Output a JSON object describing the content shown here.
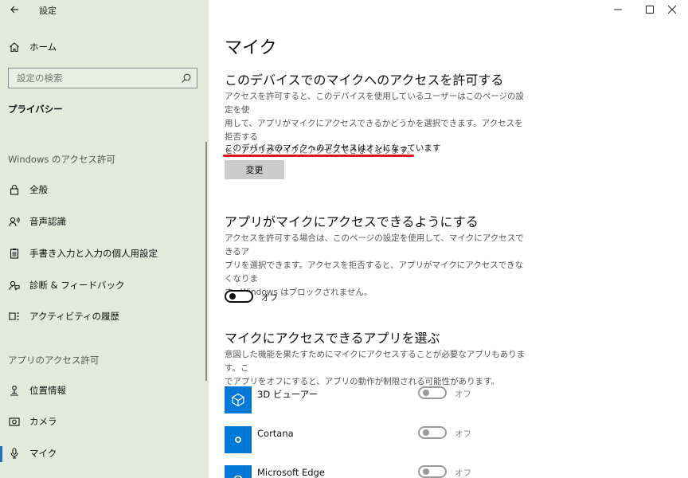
{
  "window": {
    "title": "設定",
    "back_icon": "back-arrow-icon",
    "controls": [
      "minimize-icon",
      "maximize-icon",
      "close-icon"
    ]
  },
  "sidebar": {
    "home_label": "ホーム",
    "search_placeholder": "設定の検索",
    "category_title": "プライバシー",
    "section_windows": "Windows のアクセス許可",
    "windows_items": [
      {
        "label": "全般",
        "icon": "lock-icon"
      },
      {
        "label": "音声認識",
        "icon": "speech-icon"
      },
      {
        "label": "手書き入力と入力の個人用設定",
        "icon": "clipboard-icon"
      },
      {
        "label": "診断 & フィードバック",
        "icon": "feedback-icon"
      },
      {
        "label": "アクティビティの履歴",
        "icon": "history-icon"
      }
    ],
    "section_apps": "アプリのアクセス許可",
    "app_items": [
      {
        "label": "位置情報",
        "icon": "location-icon"
      },
      {
        "label": "カメラ",
        "icon": "camera-icon"
      },
      {
        "label": "マイク",
        "icon": "microphone-icon",
        "active": true
      }
    ],
    "accent_color": "#2b6fb3",
    "background_color": "#e3eadb"
  },
  "main": {
    "page_title": "マイク",
    "device_section": {
      "heading": "このデバイスでのマイクへのアクセスを許可する",
      "description_lines": [
        "アクセスを許可すると、このデバイスを使用しているユーザーはこのページの設定を使",
        "用して、アプリがマイクにアクセスできるかどうかを選択できます。アクセスを拒否する",
        "と、アプリがマイクにアクセスできなくなります。"
      ],
      "status": "このデバイスのマイクへのアクセスはオンになっています",
      "change_button": "変更"
    },
    "apps_section": {
      "heading": "アプリがマイクにアクセスできるようにする",
      "description_lines": [
        "アクセスを許可する場合は、このページの設定を使用して、マイクにアクセスできるア",
        "プリを選択できます。アクセスを拒否すると、アプリがマイクにアクセスできなくなりま",
        "す。Windows はブロックされません。"
      ],
      "toggle_label": "オフ",
      "toggle_on": false
    },
    "choose_section": {
      "heading": "マイクにアクセスできるアプリを選ぶ",
      "description_lines": [
        "意図した機能を果たすためにマイクにアクセスすることが必要なアプリもあります。こ",
        "でアプリをオフにすると、アプリの動作が制限される可能性があります。"
      ],
      "apps": [
        {
          "name": "3D ビューアー",
          "icon": "cube-icon",
          "toggle_label": "オフ",
          "toggle_on": false
        },
        {
          "name": "Cortana",
          "icon": "cortana-icon",
          "toggle_label": "オフ",
          "toggle_on": false
        },
        {
          "name": "Microsoft Edge",
          "icon": "edge-icon",
          "toggle_label": "オフ",
          "toggle_on": false
        }
      ]
    },
    "highlight_color": "#e0141b",
    "tile_color": "#0078d7"
  }
}
